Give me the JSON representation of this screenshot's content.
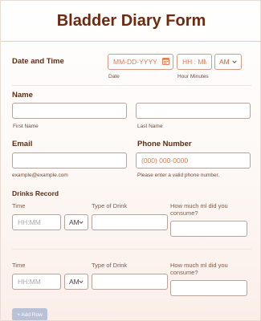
{
  "form": {
    "title": "Bladder Diary Form"
  },
  "datetime": {
    "label": "Date and Time",
    "date_placeholder": "MM-DD-YYYY",
    "date_sublabel": "Date",
    "time_placeholder": "HH : MM",
    "time_sublabel": "Hour Minutes",
    "ampm_value": "AM"
  },
  "name": {
    "label": "Name",
    "first_sublabel": "First Name",
    "last_sublabel": "Last Name"
  },
  "email": {
    "label": "Email",
    "sublabel": "example@example.com"
  },
  "phone": {
    "label": "Phone Number",
    "placeholder": "(000) 000-0000",
    "sublabel": "Please enter a valid phone number."
  },
  "drinks": {
    "label": "Drinks Record",
    "columns": [
      "Time",
      "Type of Drink",
      "How much ml did you consume?"
    ],
    "time_placeholder": "HH:MM",
    "ampm_value": "AM",
    "add_row_label": "+ Add Row"
  },
  "colors": {
    "accent": "#e07b54",
    "title": "#6e2a0f",
    "button": "#b9c1d6"
  },
  "icons": [
    "calendar-icon",
    "chevron-down-icon"
  ]
}
